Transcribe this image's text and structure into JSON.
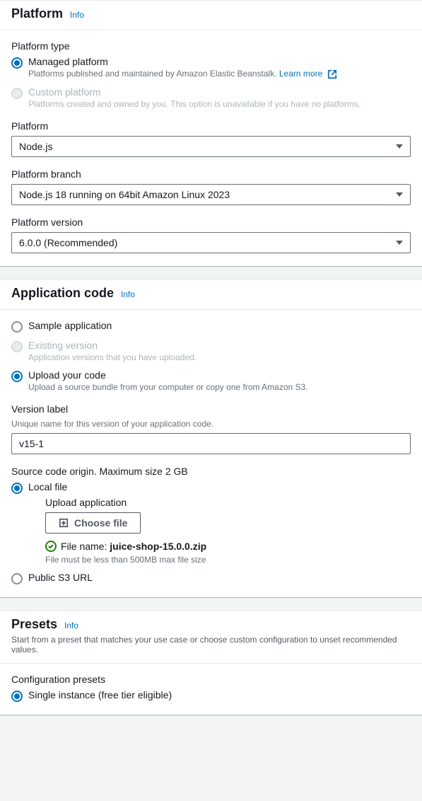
{
  "platform": {
    "header": "Platform",
    "info": "Info",
    "typeLabel": "Platform type",
    "managed": {
      "label": "Managed platform",
      "desc": "Platforms published and maintained by Amazon Elastic Beanstalk.",
      "learnMore": "Learn more"
    },
    "custom": {
      "label": "Custom platform",
      "desc": "Platforms created and owned by you. This option is unavailable if you have no platforms."
    },
    "platformLabel": "Platform",
    "platformValue": "Node.js",
    "branchLabel": "Platform branch",
    "branchValue": "Node.js 18 running on 64bit Amazon Linux 2023",
    "versionLabel": "Platform version",
    "versionValue": "6.0.0 (Recommended)"
  },
  "appCode": {
    "header": "Application code",
    "info": "Info",
    "sample": "Sample application",
    "existing": {
      "label": "Existing version",
      "desc": "Application versions that you have uploaded."
    },
    "upload": {
      "label": "Upload your code",
      "desc": "Upload a source bundle from your computer or copy one from Amazon S3."
    },
    "versionLabelTitle": "Version label",
    "versionLabelHint": "Unique name for this version of your application code.",
    "versionLabelValue": "v15-1",
    "sourceOriginTitle": "Source code origin. Maximum size 2 GB",
    "localFile": "Local file",
    "uploadAppLabel": "Upload application",
    "chooseFile": "Choose file",
    "fileNamePrefix": "File name: ",
    "fileName": "juice-shop-15.0.0.zip",
    "fileHint": "File must be less than 500MB max file size",
    "s3": "Public S3 URL"
  },
  "presets": {
    "header": "Presets",
    "info": "Info",
    "subtitle": "Start from a preset that matches your use case or choose custom configuration to unset recommended values.",
    "configLabel": "Configuration presets",
    "single": "Single instance (free tier eligible)"
  }
}
